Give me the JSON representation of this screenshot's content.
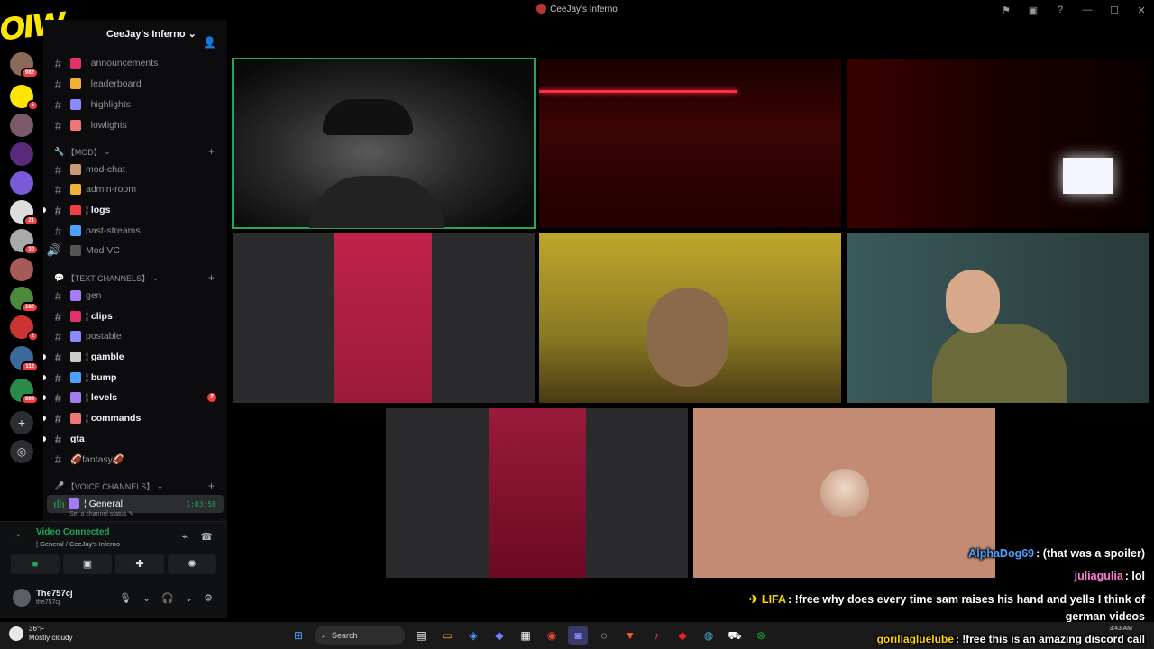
{
  "window": {
    "title": "CeeJay's Inferno",
    "controls": [
      "flag-icon",
      "notification-icon",
      "help-icon",
      "minimize-icon",
      "maximize-icon",
      "close-icon"
    ]
  },
  "rail": {
    "badges": [
      "982",
      "5",
      "21",
      "30",
      "182",
      "2",
      "112",
      "683"
    ]
  },
  "server": {
    "name": "CeeJay's Inferno"
  },
  "channels": {
    "top": [
      {
        "label": "¦ announcements",
        "unread": false,
        "color": "#e1306c"
      },
      {
        "label": "¦ leaderboard",
        "unread": false,
        "color": "#f0b232"
      },
      {
        "label": "¦ highlights",
        "unread": false,
        "color": "#8a8aff"
      },
      {
        "label": "¦ lowlights",
        "unread": false,
        "color": "#e77"
      }
    ],
    "mod_category": "【MOD】",
    "mod": [
      {
        "label": "mod-chat",
        "unread": false,
        "color": "#c97"
      },
      {
        "label": "admin-room",
        "unread": false,
        "color": "#f0b232"
      },
      {
        "label": "¦ logs",
        "unread": true,
        "color": "#f23f43"
      },
      {
        "label": "past-streams",
        "unread": false,
        "color": "#4aa3ff"
      },
      {
        "label": "Mod VC",
        "unread": false,
        "color": "#8e9297"
      }
    ],
    "text_category": "【TEXT CHANNELS】",
    "text": [
      {
        "label": "gen",
        "unread": false,
        "color": "#a77bf3"
      },
      {
        "label": "¦ clips",
        "unread": true,
        "color": "#e1306c"
      },
      {
        "label": "postable",
        "unread": false,
        "color": "#8a8aff"
      },
      {
        "label": "¦ gamble",
        "unread": true,
        "color": "#ccc"
      },
      {
        "label": "¦ bump",
        "unread": true,
        "color": "#4aa3ff"
      },
      {
        "label": "¦ levels",
        "unread": true,
        "color": "#a77bf3",
        "mentions": "2"
      },
      {
        "label": "¦ commands",
        "unread": true,
        "color": "#e77"
      },
      {
        "label": "gta",
        "unread": true,
        "color": ""
      },
      {
        "label": "🏈fantasy🏈",
        "unread": false,
        "color": ""
      }
    ],
    "voice_category": "【VOICE CHANNELS】",
    "voice": {
      "label": "¦ General",
      "timer": "1:03:58",
      "status": "Set a channel status"
    }
  },
  "voice_panel": {
    "title": "Video Connected",
    "subtitle": "¦ General / CeeJay's Inferno",
    "user": {
      "name": "The757cj",
      "tag": "the757cj"
    }
  },
  "chat": [
    {
      "name": "AlphaDog69",
      "color": "#4aa3ff",
      "text": ": (that was a spoiler)"
    },
    {
      "name": "juliagulia",
      "color": "#ff7ad9",
      "text": ": lol"
    },
    {
      "name": "✈ LIFA",
      "color": "#ffd400",
      "text": ": !free why does every time sam raises his hand and yells I think of"
    },
    {
      "name": "",
      "color": "#fff",
      "text": "german videos"
    },
    {
      "name": "gorillagluelube",
      "color": "#ffd400",
      "text": ": !free this is an amazing discord call"
    }
  ],
  "taskbar": {
    "weather_temp": "36°F",
    "weather_desc": "Mostly cloudy",
    "search_label": "Search",
    "time": "3:43 AM"
  }
}
